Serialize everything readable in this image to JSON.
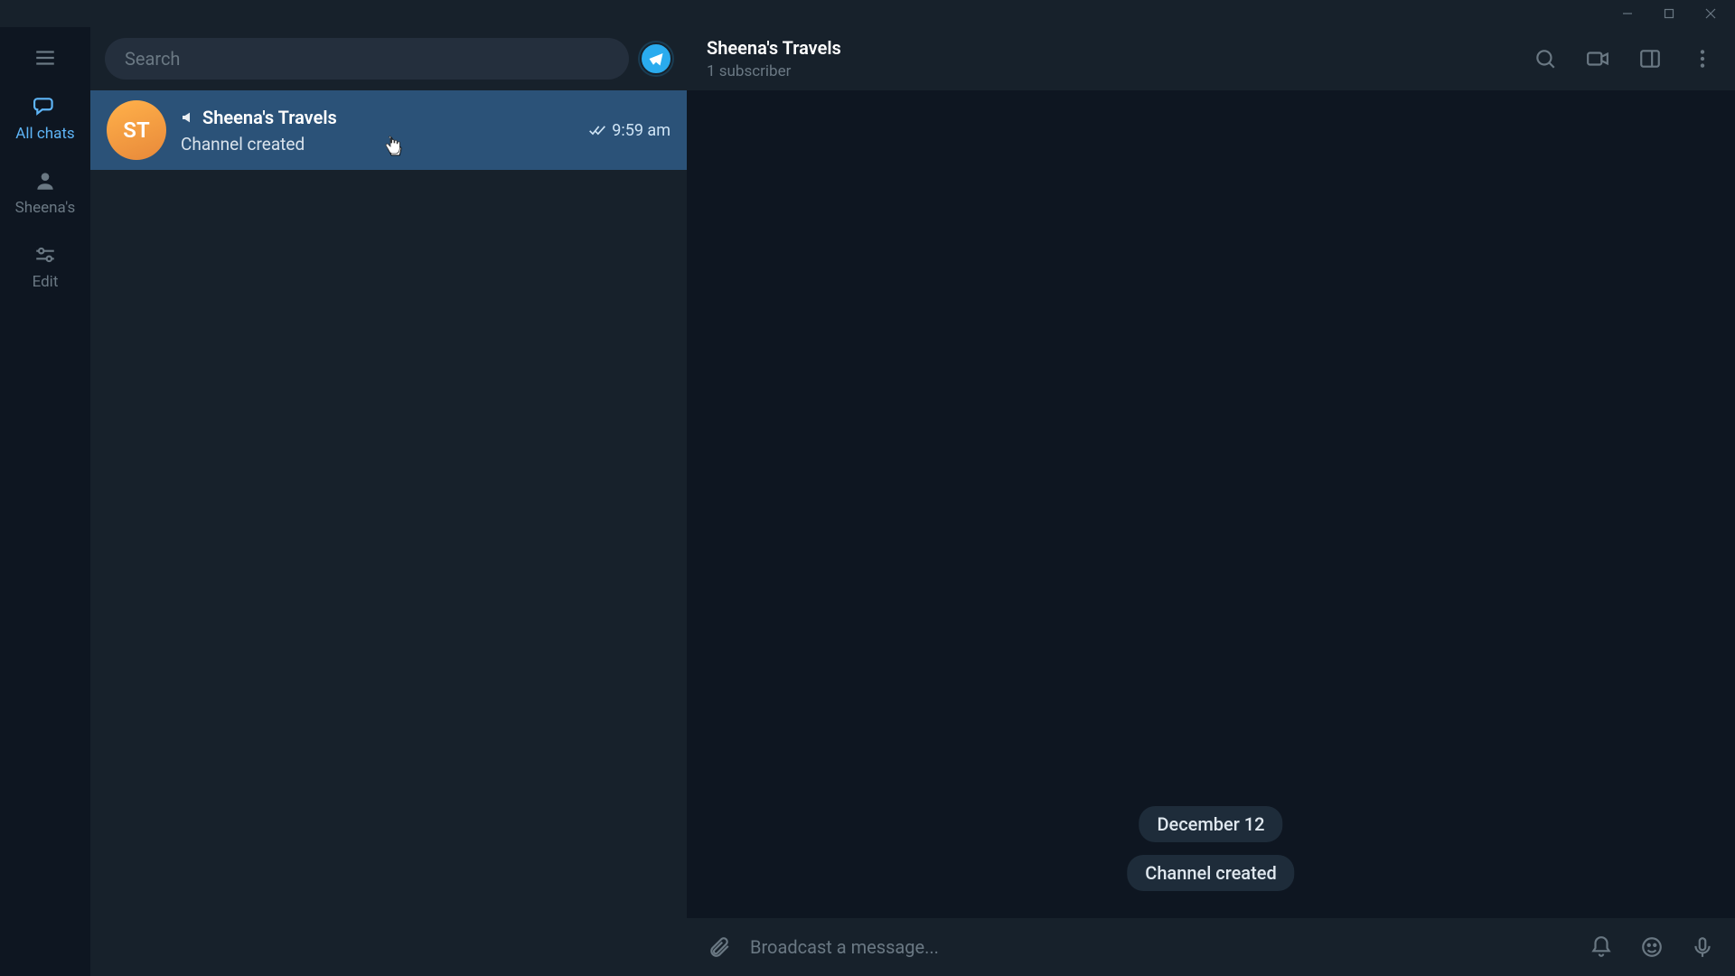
{
  "sidebar": {
    "folders": [
      {
        "label": "All chats"
      },
      {
        "label": "Sheena's"
      },
      {
        "label": "Edit"
      }
    ]
  },
  "search": {
    "placeholder": "Search"
  },
  "chatlist": {
    "items": [
      {
        "avatar_initials": "ST",
        "name": "Sheena's Travels",
        "preview": "Channel created",
        "time": "9:59 am"
      }
    ]
  },
  "conversation": {
    "title": "Sheena's Travels",
    "subtitle": "1 subscriber",
    "system_messages": [
      "December 12",
      "Channel created"
    ],
    "composer_placeholder": "Broadcast a message..."
  }
}
